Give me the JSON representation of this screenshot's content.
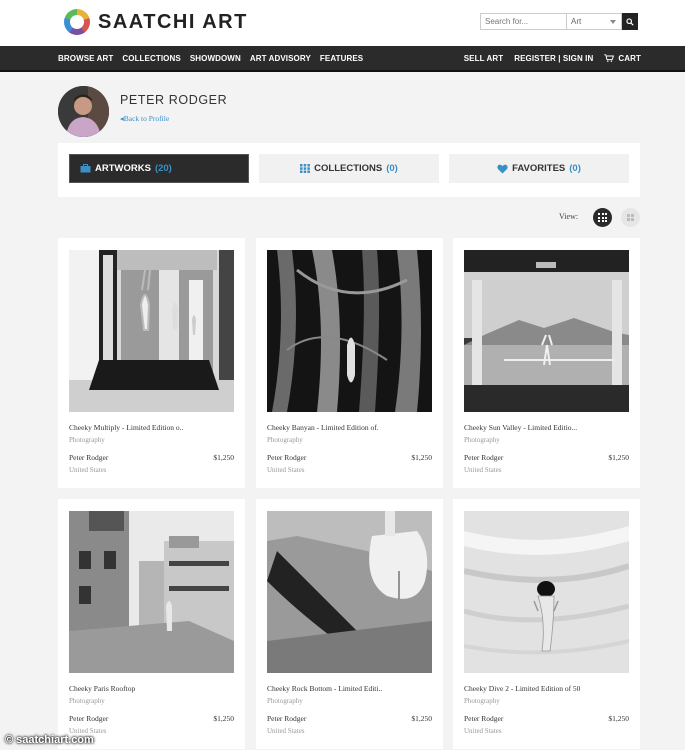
{
  "header": {
    "logo_text": "SAATCHI ART",
    "search_placeholder": "Search for...",
    "search_category": "Art"
  },
  "nav": {
    "left": [
      "BROWSE ART",
      "COLLECTIONS",
      "SHOWDOWN",
      "ART ADVISORY",
      "FEATURES"
    ],
    "sell": "SELL ART",
    "register_signin": "REGISTER | SIGN IN",
    "cart": "CART"
  },
  "profile": {
    "name": "PETER RODGER",
    "back_link": "Back to Profile"
  },
  "tabs": [
    {
      "label": "ARTWORKS",
      "count": "(20)",
      "icon": "briefcase-icon",
      "active": true
    },
    {
      "label": "COLLECTIONS",
      "count": "(0)",
      "icon": "grid-icon",
      "active": false
    },
    {
      "label": "FAVORITES",
      "count": "(0)",
      "icon": "heart-icon",
      "active": false
    }
  ],
  "view": {
    "label": "View:"
  },
  "artworks": [
    {
      "title": "Cheeky Multiply - Limited Edition o..",
      "category": "Photography",
      "artist": "Peter Rodger",
      "price": "$1,250",
      "country": "United States"
    },
    {
      "title": "Cheeky Banyan - Limited Edition of.",
      "category": "Photography",
      "artist": "Peter Rodger",
      "price": "$1,250",
      "country": "United States"
    },
    {
      "title": "Cheeky Sun Valley - Limited Editio...",
      "category": "Photography",
      "artist": "Peter Rodger",
      "price": "$1,250",
      "country": "United States"
    },
    {
      "title": "Cheeky Paris Rooftop",
      "category": "Photography",
      "artist": "Peter Rodger",
      "price": "$1,250",
      "country": "United States"
    },
    {
      "title": "Cheeky Rock Bottom - Limited Editi..",
      "category": "Photography",
      "artist": "Peter Rodger",
      "price": "$1,250",
      "country": "United States"
    },
    {
      "title": "Cheeky Dive 2 - Limited Edition of 50",
      "category": "Photography",
      "artist": "Peter Rodger",
      "price": "$1,250",
      "country": "United States"
    }
  ],
  "watermark": "© saatchiart.com",
  "colors": {
    "accent": "#3a8fc4",
    "nav_bg": "#2b2b2b"
  }
}
